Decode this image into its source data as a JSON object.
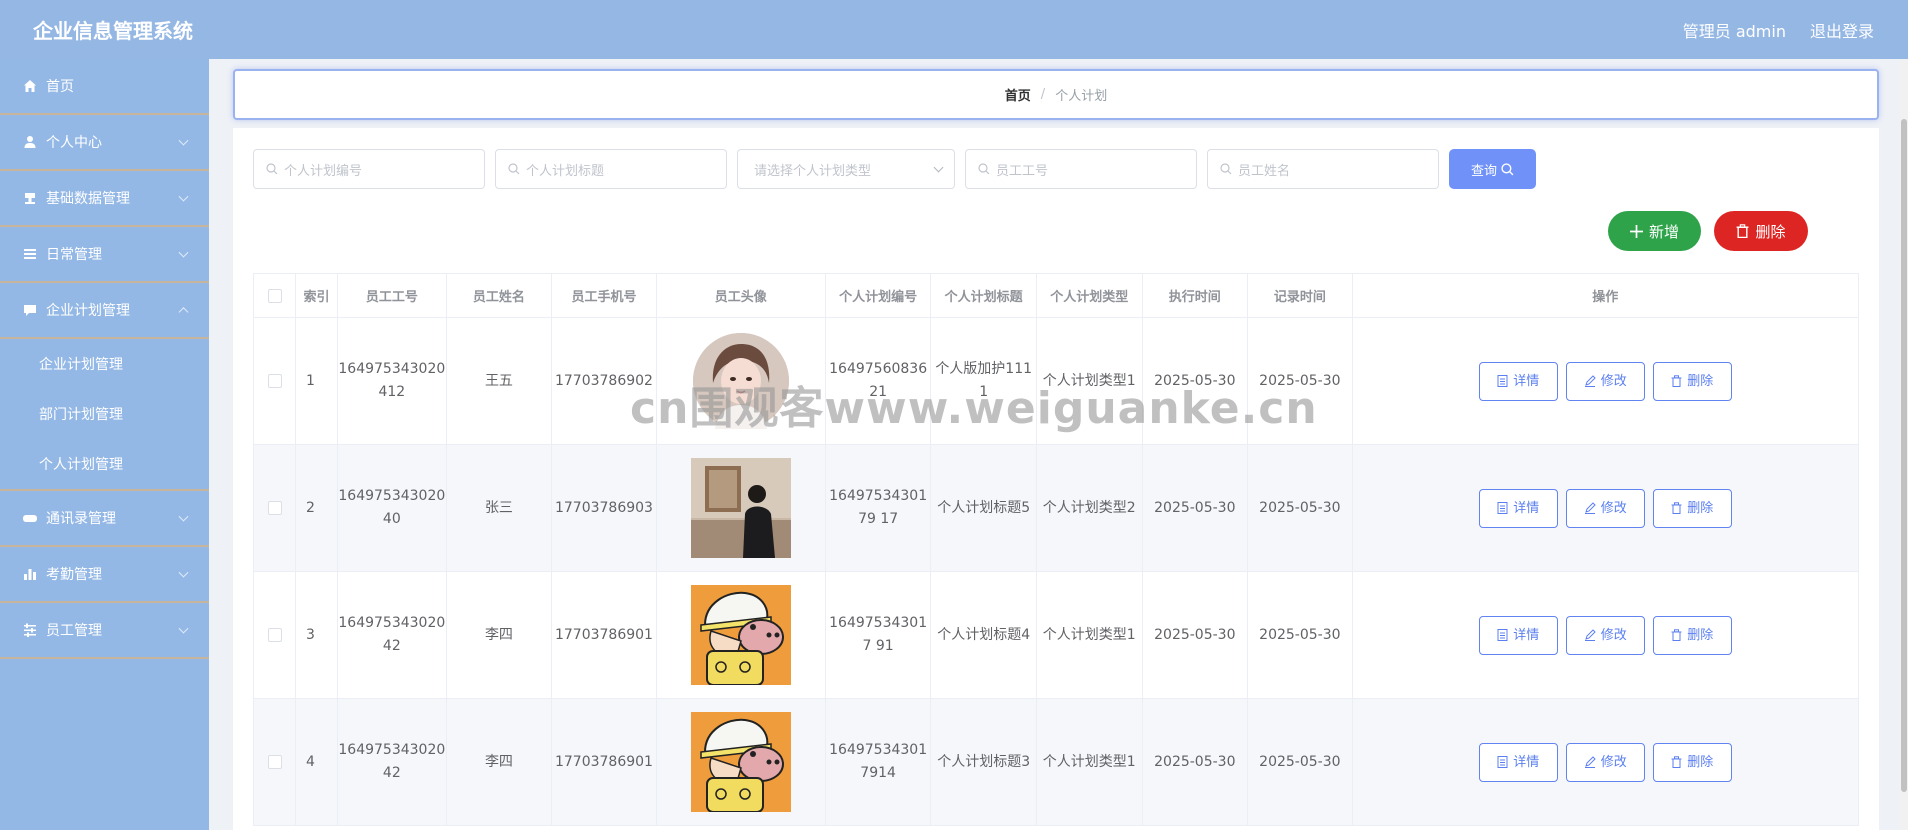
{
  "header": {
    "title": "企业信息管理系统",
    "user": "管理员 admin",
    "logout": "退出登录"
  },
  "sidebar": {
    "items": [
      {
        "label": "首页"
      },
      {
        "label": "个人中心"
      },
      {
        "label": "基础数据管理"
      },
      {
        "label": "日常管理"
      },
      {
        "label": "企业计划管理"
      },
      {
        "label": "通讯录管理"
      },
      {
        "label": "考勤管理"
      },
      {
        "label": "员工管理"
      }
    ],
    "sub": [
      {
        "label": "企业计划管理"
      },
      {
        "label": "部门计划管理"
      },
      {
        "label": "个人计划管理"
      }
    ]
  },
  "breadcrumb": {
    "home": "首页",
    "sep": "/",
    "current": "个人计划"
  },
  "search": {
    "plan_no": "个人计划编号",
    "plan_title": "个人计划标题",
    "plan_type": "请选择个人计划类型",
    "emp_no": "员工工号",
    "emp_name": "员工姓名",
    "query": "查询"
  },
  "actions": {
    "add": "新增",
    "delete": "删除"
  },
  "table": {
    "headers": [
      "索引",
      "员工工号",
      "员工姓名",
      "员工手机号",
      "员工头像",
      "个人计划编号",
      "个人计划标题",
      "个人计划类型",
      "执行时间",
      "记录时间",
      "操作"
    ],
    "rows": [
      {
        "idx": "1",
        "emp_no": "164975343020412",
        "name": "王五",
        "phone": "17703786902",
        "avatar": "girl-portrait",
        "plan_no": "1649756083621",
        "title": "个人版加护1111",
        "type": "个人计划类型1",
        "exec": "2025-05-30",
        "record": "2025-05-30"
      },
      {
        "idx": "2",
        "emp_no": "16497534302040",
        "name": "张三",
        "phone": "17703786903",
        "avatar": "museum-photo",
        "plan_no": "1649753430179 17",
        "title": "个人计划标题5",
        "type": "个人计划类型2",
        "exec": "2025-05-30",
        "record": "2025-05-30"
      },
      {
        "idx": "3",
        "emp_no": "16497534302042",
        "name": "李四",
        "phone": "17703786901",
        "avatar": "cartoon-boy",
        "plan_no": "164975343017 91",
        "title": "个人计划标题4",
        "type": "个人计划类型1",
        "exec": "2025-05-30",
        "record": "2025-05-30"
      },
      {
        "idx": "4",
        "emp_no": "16497534302042",
        "name": "李四",
        "phone": "17703786901",
        "avatar": "cartoon-boy",
        "plan_no": "164975343017914",
        "title": "个人计划标题3",
        "type": "个人计划类型1",
        "exec": "2025-05-30",
        "record": "2025-05-30"
      }
    ],
    "ops": {
      "detail": "详情",
      "edit": "修改",
      "delete": "删除"
    }
  },
  "watermark": "cn围观客www.weiguanke.cn",
  "colors": {
    "header": "#95b7e4",
    "sidebar": "#94b8e6",
    "primary": "#6f91f8",
    "success": "#2ea34a",
    "danger": "#dd2624"
  }
}
